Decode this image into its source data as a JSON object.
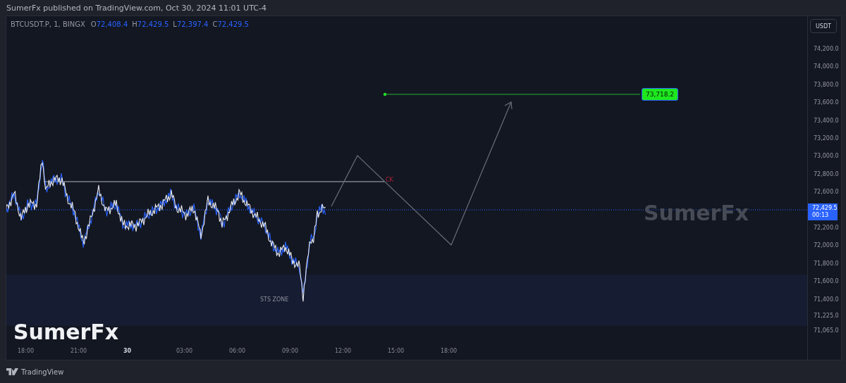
{
  "header": {
    "publish_note": "SumerFx published on TradingView.com, Oct 30, 2024 11:01 UTC-4"
  },
  "legend": {
    "symbol": "BTCUSDT.P, 1, BINGX",
    "ohlc": [
      {
        "key": "O",
        "value": "72,408.4"
      },
      {
        "key": "H",
        "value": "72,429.5"
      },
      {
        "key": "L",
        "value": "72,397.4"
      },
      {
        "key": "C",
        "value": "72,429.5"
      }
    ]
  },
  "chart": {
    "currency_button": "USDT",
    "price_labels": [
      "74,200.0",
      "74,000.0",
      "73,800.0",
      "73,600.0",
      "73,400.0",
      "73,200.0",
      "73,000.0",
      "72,800.0",
      "72,600.0",
      "72,200.0",
      "72,000.0",
      "71,800.0",
      "71,600.0",
      "71,400.0",
      "71,225.0",
      "71,065.0"
    ],
    "time_labels": [
      {
        "label": "18:00",
        "bold": false
      },
      {
        "label": "21:00",
        "bold": false
      },
      {
        "label": "30",
        "bold": true
      },
      {
        "label": "03:00",
        "bold": false
      },
      {
        "label": "06:00",
        "bold": false
      },
      {
        "label": "09:00",
        "bold": false
      },
      {
        "label": "12:00",
        "bold": false
      },
      {
        "label": "15:00",
        "bold": false
      },
      {
        "label": "18:00",
        "bold": false
      }
    ],
    "last_price": "72,429.5",
    "countdown": "00:13",
    "target_label": "73,718.2",
    "level_note": "CK",
    "zone_label": "STS ZONE",
    "center_watermark": "SumerFx",
    "corner_caption": "SumerFx"
  },
  "footer": {
    "brand": "TradingView"
  }
}
